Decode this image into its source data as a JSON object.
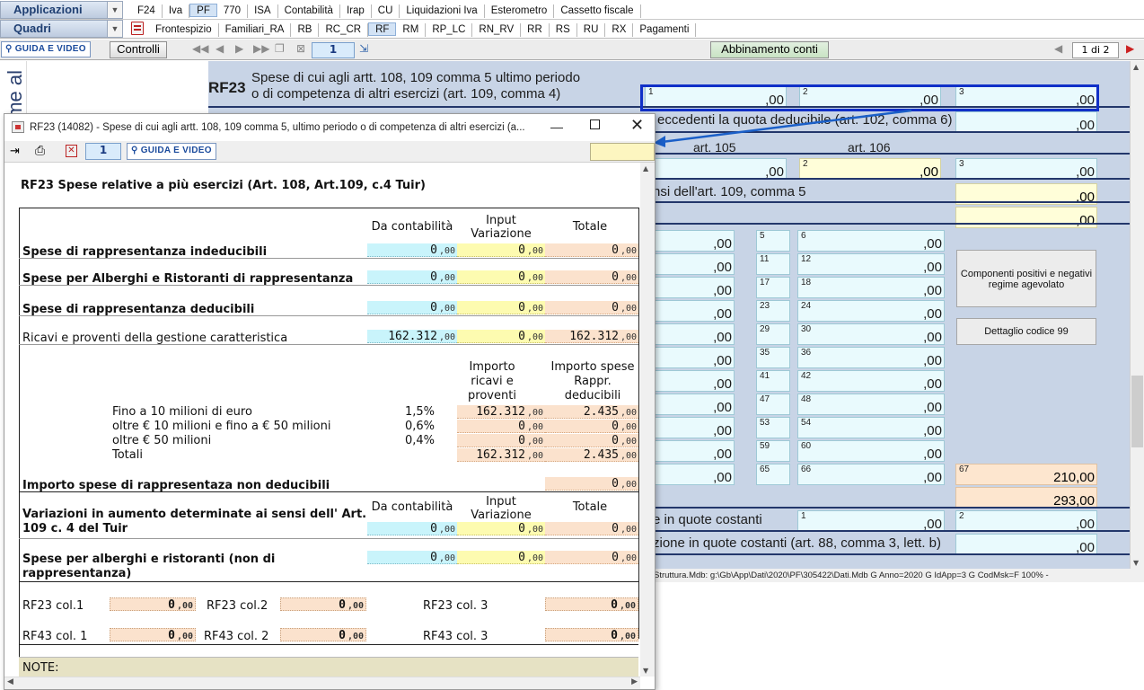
{
  "toolbar1": {
    "combo": "Applicazioni",
    "menu": [
      "F24",
      "Iva",
      "PF",
      "770",
      "ISA",
      "Contabilità",
      "Irap",
      "CU",
      "Liquidazioni Iva",
      "Esterometro",
      "Cassetto fiscale"
    ],
    "selected": "PF"
  },
  "toolbar2": {
    "combo": "Quadri",
    "menu": [
      "Frontespizio",
      "Familiari_RA",
      "RB",
      "RC_CR",
      "RF",
      "RM",
      "RP_LC",
      "RN_RV",
      "RR",
      "RS",
      "RU",
      "RX",
      "Pagamenti"
    ],
    "selected": "RF"
  },
  "toolbar3": {
    "guida": "GUIDA E VIDEO",
    "controlli": "Controlli",
    "page": "1",
    "abbinamento": "Abbinamento conti",
    "pages": "1 di 2"
  },
  "left_text": "me al",
  "bg": {
    "code": "RF23",
    "desc1": "Spese di cui agli artt. 108, 109 comma 5 ultimo periodo",
    "desc2": "o di competenza di altri esercizi (art. 109, comma 4)",
    "r2text": "eccedenti la quota deducibile (art. 102, comma 6)",
    "art105": "art. 105",
    "art106": "art. 106",
    "r4text": "nsi dell'art. 109, comma 5",
    "r17text": "e in quote costanti",
    "r18text": "zione in quote costanti (art. 88, comma 3, lett. b)",
    "zero": ",00",
    "nums": [
      "1",
      "2",
      "3",
      "5",
      "6",
      "11",
      "12",
      "17",
      "18",
      "23",
      "24",
      "29",
      "30",
      "35",
      "36",
      "41",
      "42",
      "47",
      "48",
      "53",
      "54",
      "59",
      "60",
      "65",
      "66",
      "67"
    ],
    "v210": "210",
    "v293": "293",
    "btn1": "Componenti positivi e negativi regime agevolato",
    "btn2": "Dettaglio codice 99",
    "status": "Struttura.Mdb: g:\\Gb\\App\\Dati\\2020\\PF\\305422\\Dati.Mdb G  Anno=2020 G  IdApp=3 G  CodMsk=F      100%   -"
  },
  "dialog": {
    "title": "RF23 (14082) - Spese di cui agli artt. 108, 109 comma 5, ultimo periodo o di competenza di altri esercizi (a...",
    "page": "1",
    "guida": "GUIDA E VIDEO",
    "heading": "RF23 Spese relative a più esercizi  (Art. 108, Art.109, c.4 Tuir)",
    "col_contab": "Da contabilità",
    "col_input1": "Input",
    "col_input2": "Variazione",
    "col_tot": "Totale",
    "rows": [
      {
        "label": "Spese di rappresentanza indeducibili",
        "c": "0",
        "y": "0",
        "t": "0"
      },
      {
        "label": "Spese per Alberghi e Ristoranti di rappresentanza",
        "c": "0",
        "y": "0",
        "t": "0"
      },
      {
        "label": "Spese di rappresentanza deducibili",
        "c": "0",
        "y": "0",
        "t": "0"
      },
      {
        "label": "Ricavi e proventi della gestione caratteristica",
        "c": "162.312",
        "y": "0",
        "t": "162.312"
      }
    ],
    "dec": ",00",
    "h_imp1": "Importo",
    "h_imp2": "ricavi e",
    "h_imp3": "proventi",
    "h_sp1": "Importo spese",
    "h_sp2": "Rappr.",
    "h_sp3": "deducibili",
    "scaglioni": [
      {
        "label": "Fino a 10 milioni di euro",
        "pct": "1,5%",
        "a": "162.312",
        "b": "2.435"
      },
      {
        "label": "oltre € 10 milioni e fino a € 50 milioni",
        "pct": "0,6%",
        "a": "0",
        "b": "0"
      },
      {
        "label": "oltre € 50 milioni",
        "pct": "0,4%",
        "a": "0",
        "b": "0"
      },
      {
        "label": "Totali",
        "pct": "",
        "a": "162.312",
        "b": "2.435"
      }
    ],
    "nondeduc_label": "Importo spese di rappresentaza non deducibili",
    "nondeduc": "0",
    "var_label1": "Variazioni in aumento determinate ai sensi dell' Art.",
    "var_label2": "109 c. 4 del Tuir",
    "var": {
      "c": "0",
      "y": "0",
      "t": "0"
    },
    "alb_label1": "Spese per alberghi e ristoranti (non di",
    "alb_label2": "rappresentanza)",
    "alb": {
      "c": "0",
      "y": "0",
      "t": "0"
    },
    "rf23c1": "RF23 col.1",
    "rf23c2": "RF23 col.2",
    "rf23c3": "RF23 col. 3",
    "rf43c1": "RF43 col. 1",
    "rf43c2": "RF43 col. 2",
    "rf43c3": "RF43 col. 3",
    "zero": "0",
    "note": "NOTE:"
  }
}
